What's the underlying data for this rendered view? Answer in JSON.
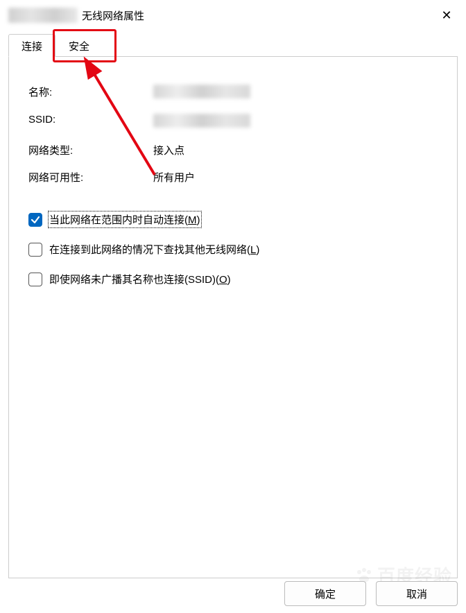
{
  "titlebar": {
    "title_suffix": "无线网络属性"
  },
  "tabs": {
    "connect": "连接",
    "security": "安全"
  },
  "info": {
    "name_label": "名称:",
    "ssid_label": "SSID:",
    "type_label": "网络类型:",
    "type_value": "接入点",
    "avail_label": "网络可用性:",
    "avail_value": "所有用户"
  },
  "checkboxes": {
    "auto_connect": {
      "label": "当此网络在范围内时自动连接(",
      "accel": "M",
      "tail": ")",
      "checked": true
    },
    "look_other": {
      "label": "在连接到此网络的情况下查找其他无线网络(",
      "accel": "L",
      "tail": ")",
      "checked": false
    },
    "hidden_ssid": {
      "label": "即使网络未广播其名称也连接(SSID)(",
      "accel": "O",
      "tail": ")",
      "checked": false
    }
  },
  "buttons": {
    "ok": "确定",
    "cancel": "取消"
  },
  "watermark": "百度经验"
}
